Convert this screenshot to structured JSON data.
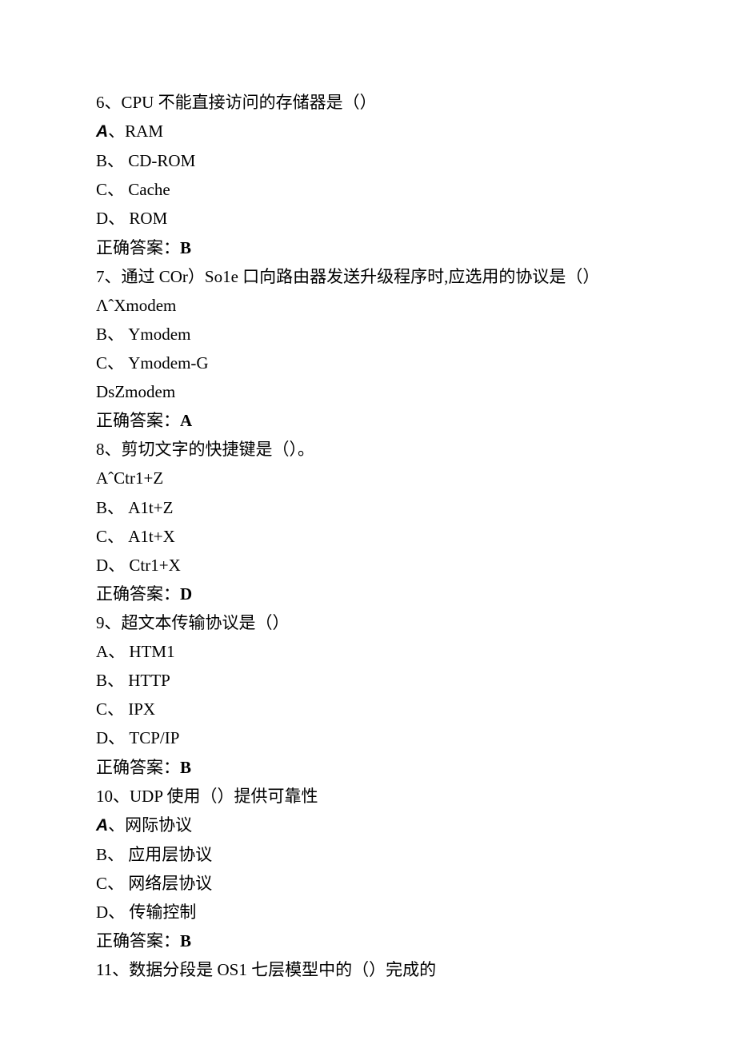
{
  "q6": {
    "stem": "6、CPU 不能直接访问的存储器是（）",
    "optA_prefix": "A",
    "optA_sep": "、",
    "optA_text": "RAM",
    "optB": "B、 CD-ROM",
    "optC": "C、 Cache",
    "optD": "D、 ROM",
    "answer_label": "正确答案：",
    "answer_value": "B"
  },
  "q7": {
    "stem": "7、通过 COr）So1e 口向路由器发送升级程序时,应选用的协议是（）",
    "optA": "ΛˆXmodem",
    "optB": "B、 Ymodem",
    "optC": "C、 Ymodem-G",
    "optD": "DsZmodem",
    "answer_label": "正确答案：",
    "answer_value": "A"
  },
  "q8": {
    "stem": "8、剪切文字的快捷键是（）。",
    "optA": "AˆCtr1+Z",
    "optB": "B、 A1t+Z",
    "optC": "C、 A1t+X",
    "optD": "D、 Ctr1+X",
    "answer_label": "正确答案：",
    "answer_value": "D"
  },
  "q9": {
    "stem": "9、超文本传输协议是（）",
    "optA": "A、 HTM1",
    "optB": "B、 HTTP",
    "optC": "C、 IPX",
    "optD": "D、 TCP/IP",
    "answer_label": "正确答案：",
    "answer_value": "B"
  },
  "q10": {
    "stem": "10、UDP 使用（）提供可靠性",
    "optA_prefix": "A",
    "optA_sep": "、",
    "optA_text": "网际协议",
    "optB": "B、 应用层协议",
    "optC": "C、 网络层协议",
    "optD": "D、 传输控制",
    "answer_label": "正确答案：",
    "answer_value": "B"
  },
  "q11": {
    "stem": "11、数据分段是 OS1 七层模型中的（）完成的"
  }
}
